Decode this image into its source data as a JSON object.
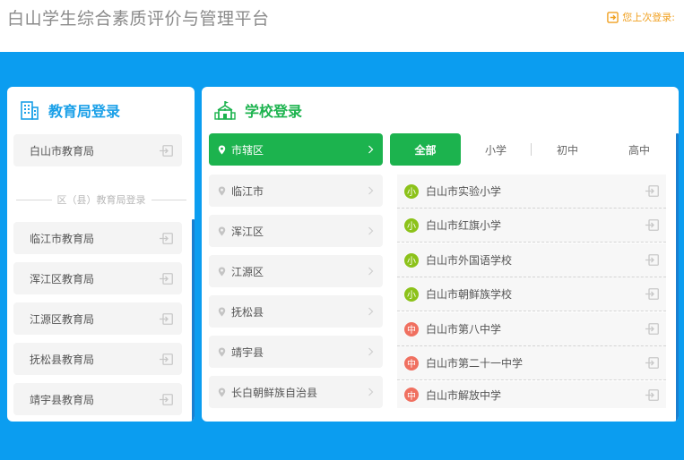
{
  "header": {
    "title": "白山学生综合素质评价与管理平台",
    "last_login": "您上次登录:"
  },
  "colors": {
    "blue": "#0b9df0",
    "green": "#1cb34e",
    "bureau_title": "#1aa0e8",
    "primary_badge": "#8cc21a",
    "middle_badge": "#f07060",
    "last_login": "#f0a020"
  },
  "bureau_panel": {
    "title": "教育局登录",
    "city_bureau": "白山市教育局",
    "divider": "区（县）教育局登录",
    "items": [
      {
        "label": "临江市教育局"
      },
      {
        "label": "浑江区教育局"
      },
      {
        "label": "江源区教育局"
      },
      {
        "label": "抚松县教育局"
      },
      {
        "label": "靖宇县教育局"
      }
    ]
  },
  "school_panel": {
    "title": "学校登录",
    "districts": [
      {
        "label": "市辖区"
      },
      {
        "label": "临江市"
      },
      {
        "label": "浑江区"
      },
      {
        "label": "江源区"
      },
      {
        "label": "抚松县"
      },
      {
        "label": "靖宇县"
      },
      {
        "label": "长白朝鲜族自治县"
      }
    ],
    "tabs": [
      {
        "label": "全部"
      },
      {
        "label": "小学"
      },
      {
        "label": "初中"
      },
      {
        "label": "高中"
      }
    ],
    "schools": [
      {
        "badge": "小",
        "label": "白山市实验小学"
      },
      {
        "badge": "小",
        "label": "白山市红旗小学"
      },
      {
        "badge": "小",
        "label": "白山市外国语学校"
      },
      {
        "badge": "小",
        "label": "白山市朝鲜族学校"
      },
      {
        "badge": "中",
        "label": "白山市第八中学"
      },
      {
        "badge": "中",
        "label": "白山市第二十一中学"
      },
      {
        "badge": "中",
        "label": "白山市解放中学"
      }
    ]
  }
}
